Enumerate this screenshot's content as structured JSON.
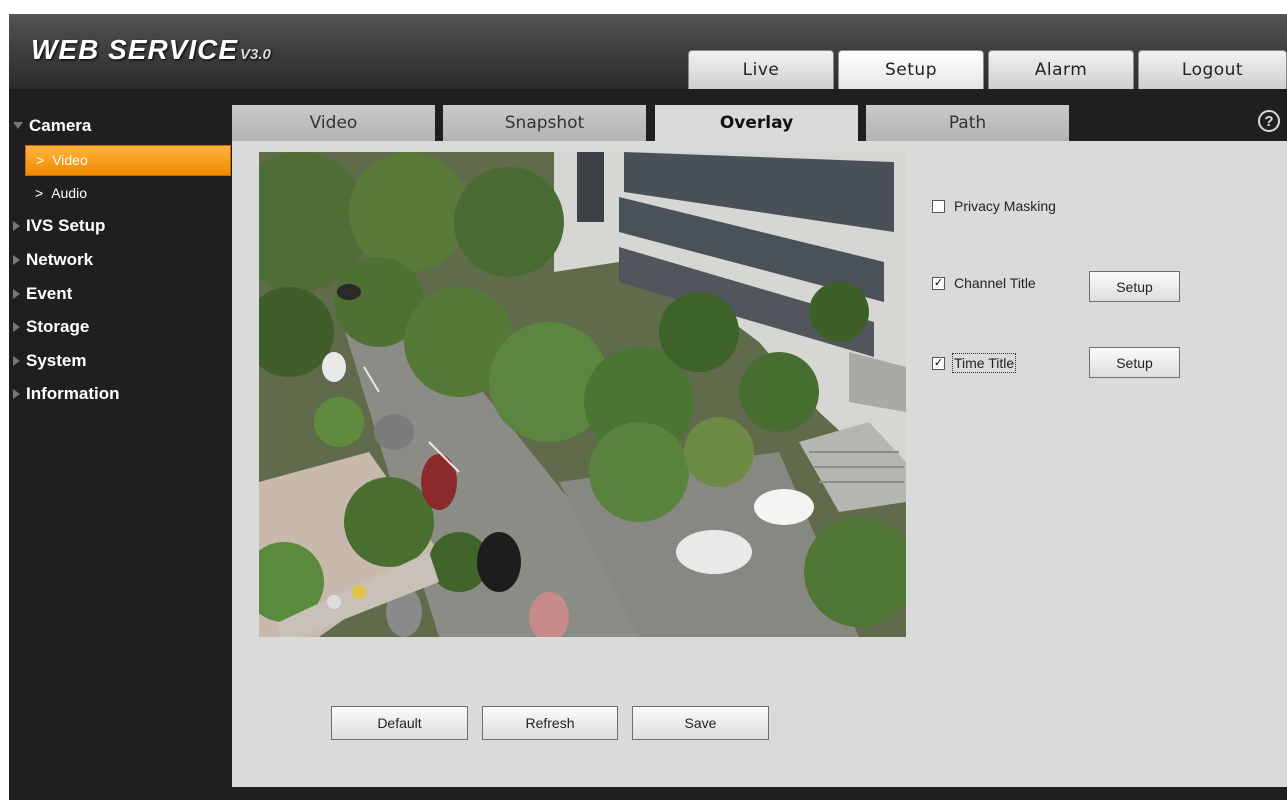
{
  "header": {
    "logo": "WEB SERVICE",
    "logo_version": "V3.0",
    "tabs": [
      {
        "label": "Live"
      },
      {
        "label": "Setup"
      },
      {
        "label": "Alarm"
      },
      {
        "label": "Logout"
      }
    ],
    "active_tab": "Setup"
  },
  "sidebar": {
    "camera": {
      "label": "Camera",
      "children": [
        {
          "label": "Video"
        },
        {
          "label": "Audio"
        }
      ],
      "active_child": "Video"
    },
    "groups": [
      {
        "label": "IVS Setup"
      },
      {
        "label": "Network"
      },
      {
        "label": "Event"
      },
      {
        "label": "Storage"
      },
      {
        "label": "System"
      },
      {
        "label": "Information"
      }
    ]
  },
  "content": {
    "tabs": [
      {
        "label": "Video"
      },
      {
        "label": "Snapshot"
      },
      {
        "label": "Overlay"
      },
      {
        "label": "Path"
      }
    ],
    "active_tab": "Overlay",
    "help_icon": "help-circle-icon",
    "options": {
      "privacy_masking": {
        "label": "Privacy Masking",
        "checked": false
      },
      "channel_title": {
        "label": "Channel Title",
        "checked": true,
        "button": "Setup"
      },
      "time_title": {
        "label": "Time Title",
        "checked": true,
        "button": "Setup"
      }
    },
    "buttons": {
      "default": "Default",
      "refresh": "Refresh",
      "save": "Save"
    }
  },
  "colors": {
    "accent": "#f39a1a",
    "background": "#1f1f1f",
    "panel": "#dadada"
  }
}
